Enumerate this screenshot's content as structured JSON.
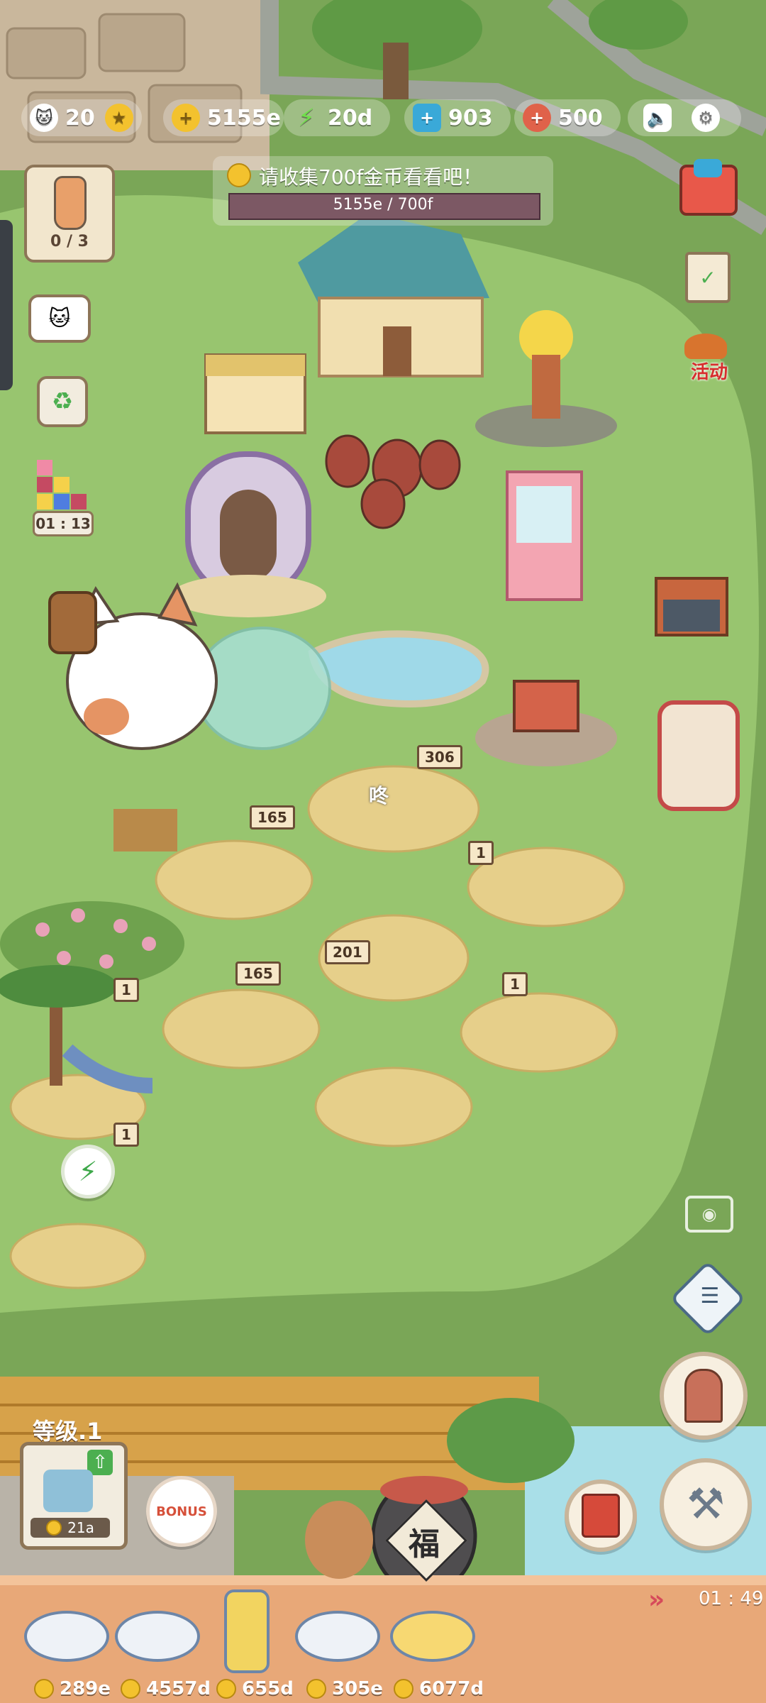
{
  "hud": {
    "cats": "20",
    "coins": "5155e",
    "energy": "20d",
    "gems": "903",
    "food": "500"
  },
  "quest": {
    "text": "请收集700f金币看看吧！",
    "progress_text": "5155e / 700f",
    "progress": 1.0
  },
  "left_panel": {
    "bottle_count": "0 / 3",
    "puzzle_timer": "01 : 13"
  },
  "right_panel": {
    "event_label": "活动"
  },
  "stations": {
    "s1": "306",
    "s2": "165",
    "s3": "201",
    "s4": "165",
    "s5": "1",
    "s6": "1",
    "s7": "1",
    "s8": "1",
    "steam": "咚"
  },
  "shop": {
    "level_label": "等级.1",
    "upgrade_cost": "21a",
    "bonus_label": "BONUS",
    "jar_label": "福",
    "timer": "01 : 49"
  },
  "dishes": [
    {
      "cost": "289e"
    },
    {
      "cost": "4557d"
    },
    {
      "cost": "655d"
    },
    {
      "cost": "305e"
    },
    {
      "cost": "6077d"
    }
  ],
  "colors": {
    "grass": "#8fba68",
    "grass_dark": "#7aa657",
    "path": "#a2a49a",
    "counter": "#e8a878",
    "roof": "#d7a24a",
    "water": "#9fd9e8"
  }
}
